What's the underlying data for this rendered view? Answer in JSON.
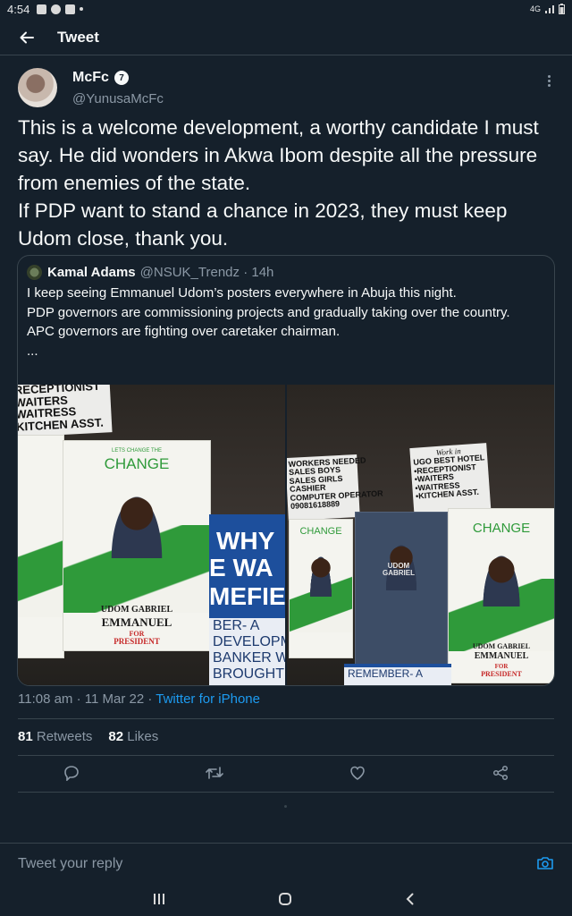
{
  "status": {
    "time": "4:54",
    "network": "4G"
  },
  "header": {
    "title": "Tweet"
  },
  "tweet": {
    "name": "McFc",
    "handle": "@YunusaMcFc",
    "text": "This is a welcome development, a worthy candidate I must say. He did wonders in Akwa Ibom despite all the pressure from enemies of the state.\nIf PDP want to stand a chance in 2023, they must keep Udom close, thank you.",
    "timestamp": "11:08 am · 11 Mar 22 · ",
    "source": "Twitter for iPhone",
    "retweets": "81",
    "retweets_label": "Retweets",
    "likes": "82",
    "likes_label": "Likes"
  },
  "quote": {
    "name": "Kamal Adams",
    "handle": "@NSUK_Trendz · 14h",
    "text": "I keep seeing Emmanuel Udom’s posters everywhere in Abuja this night.\nPDP governors are commissioning projects and gradually taking over the country.\nAPC governors are fighting over caretaker chairman.\n..."
  },
  "media": {
    "left": {
      "sign": "RECEPTIONIST\nWAITERS\nWAITRESS\nKITCHEN ASST.",
      "poster_change_small": "LETS CHANGE THE",
      "poster_change": "CHANGE",
      "poster_name1": "UDOM GABRIEL",
      "poster_name2": "EMMANUEL",
      "poster_for": "FOR",
      "poster_president": "PRESIDENT",
      "blue_why": "WHY",
      "blue_ewa": "E WA",
      "blue_mefie": "MEFIE",
      "blue_bottom": "BER- A\nDEVELOPMENT\nBANKER WAS\nBROUGHT IN TO"
    },
    "right": {
      "sign1": "WORKERS NEEDED\nSALES BOYS\nSALES GIRLS\nCASHIER\nCOMPUTER OPERATOR\n09081618889",
      "sign2_title": "Work in",
      "sign2": "UGO BEST HOTEL\n•RECEPTIONIST\n•WAITERS\n•WAITRESS\n•KITCHEN ASST.",
      "poster_change": "CHANGE",
      "poster_name1": "UDOM GABRIEL",
      "poster_name2": "EMMANUEL",
      "poster_for": "FOR",
      "poster_president": "PRESIDENT",
      "mid_name": "UDOM\nGABRIEL",
      "blue_bottom": "REMEMBER- A"
    }
  },
  "reply": {
    "placeholder": "Tweet your reply"
  },
  "colors": {
    "background": "#15202b",
    "accent": "#1d9bf0",
    "muted": "#8b98a5",
    "divider": "#38444d"
  }
}
